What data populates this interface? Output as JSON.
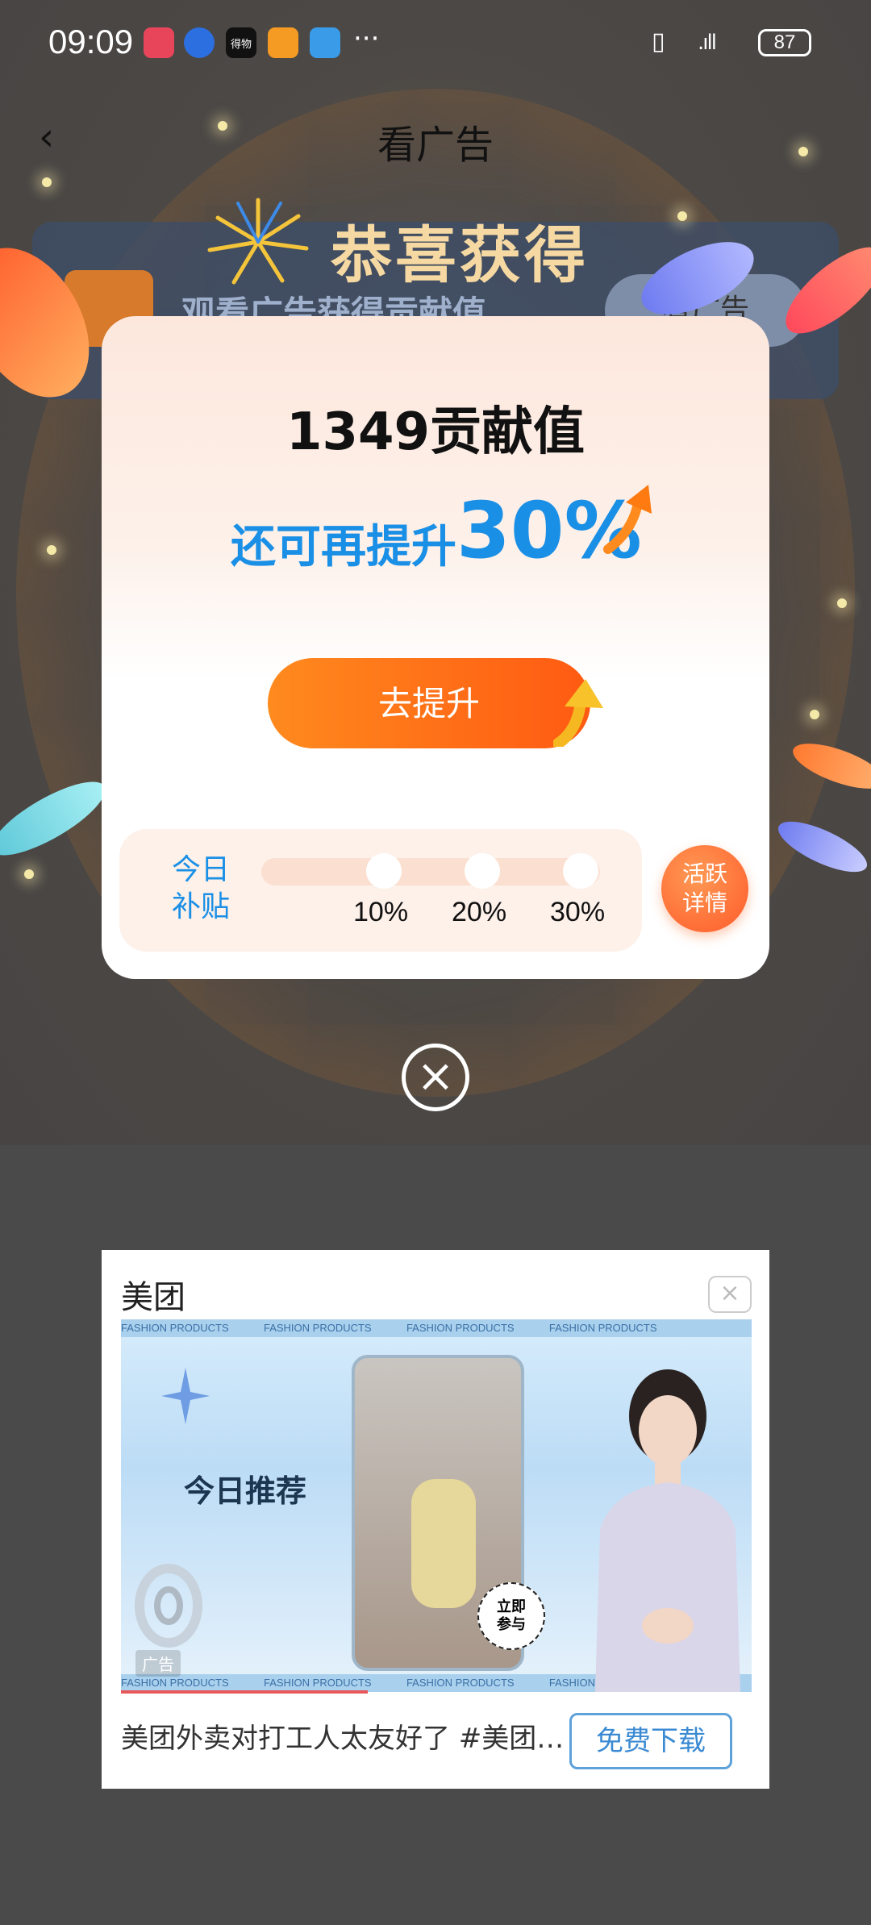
{
  "status_bar": {
    "time": "09:09",
    "app_icons": [
      "app-icon-1",
      "app-icon-2",
      "app-icon-3",
      "app-icon-4",
      "app-icon-5"
    ],
    "icon_3_text": "得物",
    "more": "···",
    "battery": "87"
  },
  "header": {
    "title": "看广告"
  },
  "banner": {
    "text": "观看广告获得贡献值",
    "button": "看广告"
  },
  "popup": {
    "heading": "恭喜获得",
    "amount": "1349贡献值",
    "boost_label": "还可再提升",
    "boost_percent": "30%",
    "cta": "去提升",
    "subsidy_label": "今日补贴",
    "steps": [
      "10%",
      "20%",
      "30%"
    ],
    "active_button": "活跃详情"
  },
  "close_icon": "×",
  "ad": {
    "brand": "美团",
    "close": "×",
    "strip_text": "FASHION PRODUCTS",
    "image_headline": "今日推荐",
    "join_badge": "立即参与",
    "ad_tag": "广告",
    "description": "美团外卖对打工人太友好了 #美团外卖",
    "download": "免费下载"
  }
}
